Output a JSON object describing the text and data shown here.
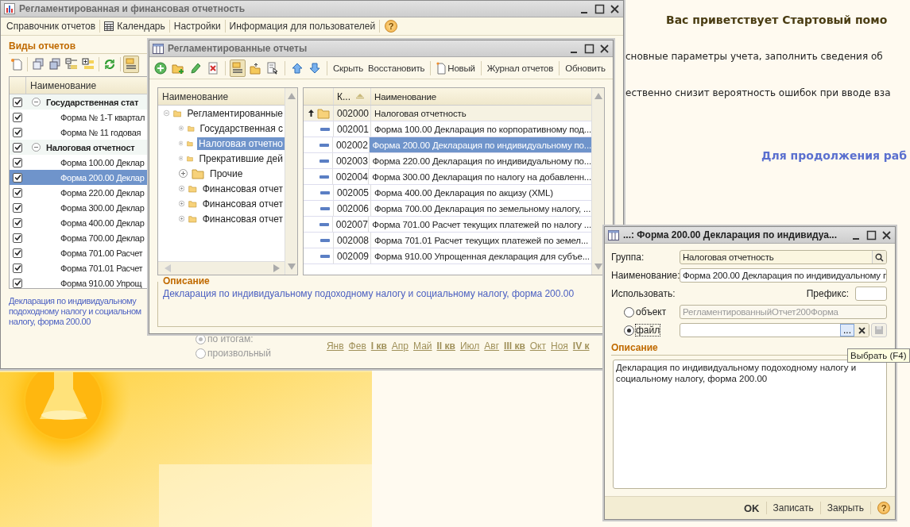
{
  "start_page": {
    "heading": "Вас приветствует Стартовый помо",
    "lines": [
      "сновные параметры учета, заполнить сведения об",
      "ественно снизит вероятность ошибок при вводе вза"
    ],
    "link": "Для продолжения раб"
  },
  "main_window": {
    "title": "Регламентированная и финансовая отчетность",
    "active": false,
    "menu": [
      {
        "label": "Справочник отчетов",
        "kind": "text"
      },
      {
        "label": "Календарь",
        "kind": "calendar"
      },
      {
        "label": "Настройки",
        "kind": "text"
      },
      {
        "label": "Информация для пользователей",
        "kind": "text"
      }
    ],
    "help": "?",
    "section_title": "Виды отчетов",
    "toolbar": [
      {
        "kind": "new-doc",
        "pressed": false
      },
      {
        "kind": "copy",
        "pressed": false
      },
      {
        "kind": "check-all",
        "pressed": false
      },
      {
        "kind": "tree-list",
        "pressed": false
      },
      {
        "kind": "add-item",
        "pressed": false
      },
      {
        "kind": "refresh",
        "pressed": false
      },
      {
        "kind": "hierarchy",
        "pressed": true
      }
    ],
    "table": {
      "columns": [
        "Наименование"
      ],
      "rows": [
        {
          "kind": "group",
          "label": "Государственная стат",
          "checked": true,
          "expanded": true,
          "selected": false
        },
        {
          "kind": "item",
          "label": "Форма № 1-Т квартал",
          "checked": true,
          "selected": false
        },
        {
          "kind": "item",
          "label": "Форма № 11 годовая",
          "checked": true,
          "selected": false
        },
        {
          "kind": "group",
          "label": "Налоговая отчетност",
          "checked": true,
          "expanded": true,
          "selected": false
        },
        {
          "kind": "item",
          "label": "Форма 100.00 Деклар",
          "checked": true,
          "selected": false
        },
        {
          "kind": "item",
          "label": "Форма 200.00 Деклар",
          "checked": true,
          "selected": true
        },
        {
          "kind": "item",
          "label": "Форма 220.00 Деклар",
          "checked": true,
          "selected": false
        },
        {
          "kind": "item",
          "label": "Форма 300.00 Деклар",
          "checked": true,
          "selected": false
        },
        {
          "kind": "item",
          "label": "Форма 400.00 Деклар",
          "checked": true,
          "selected": false
        },
        {
          "kind": "item",
          "label": "Форма 700.00 Деклар",
          "checked": true,
          "selected": false
        },
        {
          "kind": "item",
          "label": "Форма 701.00 Расчет",
          "checked": true,
          "selected": false
        },
        {
          "kind": "item",
          "label": "Форма 701.01 Расчет",
          "checked": true,
          "selected": false
        },
        {
          "kind": "item",
          "label": "Форма 910.00 Упрощ",
          "checked": true,
          "selected": false
        }
      ]
    },
    "description_lines": [
      "Декларация по индивидуальному",
      "подоходному налогу и социальном",
      "налогу, форма 200.00"
    ],
    "period_options": [
      {
        "label": "по итогам:",
        "selected": true
      },
      {
        "label": "произвольный",
        "selected": false
      }
    ],
    "months": [
      {
        "label": "Янв",
        "kind": "month"
      },
      {
        "label": "Фев",
        "kind": "month"
      },
      {
        "label": "I кв",
        "kind": "quarter"
      },
      {
        "label": "Апр",
        "kind": "month"
      },
      {
        "label": "Май",
        "kind": "month"
      },
      {
        "label": "II кв",
        "kind": "quarter"
      },
      {
        "label": "Июл",
        "kind": "month"
      },
      {
        "label": "Авг",
        "kind": "month"
      },
      {
        "label": "III кв",
        "kind": "quarter"
      },
      {
        "label": "Окт",
        "kind": "month"
      },
      {
        "label": "Ноя",
        "kind": "month"
      },
      {
        "label": "IV к",
        "kind": "quarter"
      }
    ]
  },
  "reports_window": {
    "title": "Регламентированные отчеты",
    "active": false,
    "toolbar": [
      {
        "kind": "add",
        "pressed": false
      },
      {
        "kind": "add-folder",
        "pressed": false
      },
      {
        "kind": "edit",
        "pressed": false
      },
      {
        "kind": "delete",
        "pressed": false
      },
      {
        "kind": "hierarchy",
        "pressed": true
      },
      {
        "kind": "level-up",
        "pressed": false
      },
      {
        "kind": "select",
        "pressed": false
      },
      {
        "kind": "up",
        "pressed": false
      },
      {
        "kind": "down",
        "pressed": false
      }
    ],
    "text_buttons": [
      {
        "label": "Скрыть",
        "kind": "text"
      },
      {
        "label": "Восстановить",
        "kind": "text"
      },
      {
        "label": "Новый",
        "kind": "new"
      },
      {
        "label": "Журнал отчетов",
        "kind": "text"
      },
      {
        "label": "Обновить",
        "kind": "text"
      }
    ],
    "tree": {
      "column": "Наименование",
      "root": {
        "label": "Регламентированные",
        "expanded": true,
        "selected": false,
        "children": [
          {
            "label": "Государственная с",
            "expanded": false,
            "selected": false
          },
          {
            "label": "Налоговая отчетно",
            "expanded": false,
            "selected": true
          },
          {
            "label": "Прекратившие дей",
            "expanded": false,
            "selected": false
          },
          {
            "label": "Прочие",
            "expanded": false,
            "selected": false
          },
          {
            "label": "Финансовая отчет",
            "expanded": false,
            "selected": false
          },
          {
            "label": "Финансовая отчет",
            "expanded": false,
            "selected": false
          },
          {
            "label": "Финансовая отчет",
            "expanded": false,
            "selected": false
          }
        ]
      }
    },
    "list": {
      "columns": [
        "К...",
        "Наименование"
      ],
      "rows": [
        {
          "kind": "folder",
          "code": "002000",
          "name": "Налоговая отчетность",
          "selected": false
        },
        {
          "kind": "item",
          "code": "002001",
          "name": "Форма 100.00 Декларация по корпоративному под...",
          "selected": false
        },
        {
          "kind": "item",
          "code": "002002",
          "name": "Форма 200.00 Декларация по индивидуальному по...",
          "selected": true
        },
        {
          "kind": "item",
          "code": "002003",
          "name": "Форма 220.00 Декларация по индивидуальному по...",
          "selected": false
        },
        {
          "kind": "item",
          "code": "002004",
          "name": "Форма 300.00 Декларация по налогу на добавленн...",
          "selected": false
        },
        {
          "kind": "item",
          "code": "002005",
          "name": "Форма 400.00 Декларация по акцизу (XML)",
          "selected": false
        },
        {
          "kind": "item",
          "code": "002006",
          "name": "Форма 700.00 Декларация по земельному налогу, ...",
          "selected": false
        },
        {
          "kind": "item",
          "code": "002007",
          "name": "Форма 701.00 Расчет текущих платежей по налогу ...",
          "selected": false
        },
        {
          "kind": "item",
          "code": "002008",
          "name": "Форма 701.01 Расчет текущих платежей по земел...",
          "selected": false
        },
        {
          "kind": "item",
          "code": "002009",
          "name": "Форма 910.00 Упрощенная декларация для субъе...",
          "selected": false
        }
      ]
    },
    "description_title": "Описание",
    "description": "Декларация по индивидуальному подоходному налогу и социальному налогу, форма 200.00"
  },
  "dialog": {
    "title": "...: Форма 200.00 Декларация по индивидуа...",
    "active": true,
    "group_label": "Группа:",
    "group_value": "Налоговая отчетность",
    "name_label": "Наименование:",
    "name_value": "Форма 200.00 Декларация по индивидуальному п",
    "use_label": "Использовать:",
    "prefix_label": "Префикс:",
    "options": [
      {
        "label": "объект",
        "selected": false,
        "value": "РегламентированныйОтчет200Форма"
      },
      {
        "label": "файл",
        "selected": true
      }
    ],
    "choose_button": "...",
    "description_title": "Описание",
    "description": "Декларация по индивидуальному подоходному налогу и социальному налогу, форма 200.00",
    "buttons": [
      {
        "label": "OK",
        "kind": "default"
      },
      {
        "label": "Записать",
        "kind": "normal"
      },
      {
        "label": "Закрыть",
        "kind": "normal"
      },
      {
        "label": "?",
        "kind": "help"
      }
    ]
  },
  "tooltip": "Выбрать (F4)"
}
